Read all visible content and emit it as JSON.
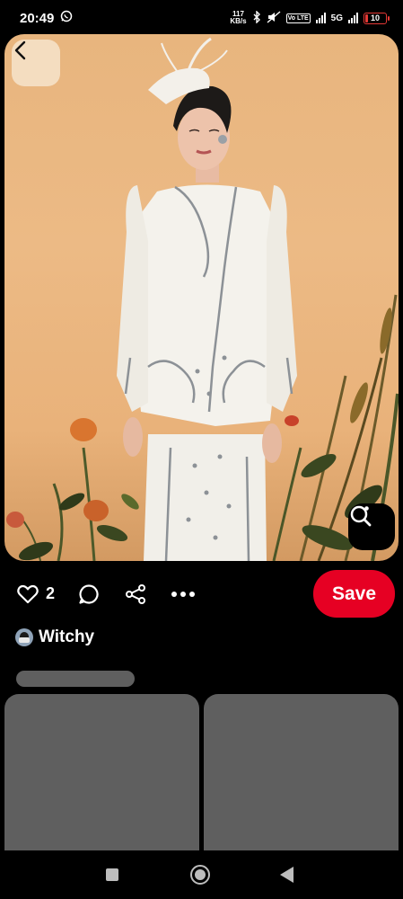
{
  "status_bar": {
    "time": "20:49",
    "net_speed_value": "117",
    "net_speed_unit": "KB/s",
    "network": "5G",
    "volte": "Vo LTE",
    "battery": "10",
    "icons": [
      "whatsapp-icon",
      "bluetooth-icon",
      "silent-icon",
      "volte-icon",
      "signal-icon",
      "battery-icon"
    ]
  },
  "pin": {
    "image_icons": [
      "back-arrow-icon",
      "visual-search-icon"
    ]
  },
  "actions": {
    "like_count": "2",
    "save_label": "Save",
    "icons": [
      "heart-icon",
      "comment-icon",
      "share-icon",
      "more-icon"
    ]
  },
  "creator": {
    "name": "Witchy"
  },
  "colors": {
    "save": "#e60023",
    "background": "#000000",
    "skeleton": "#5f5f5f"
  }
}
